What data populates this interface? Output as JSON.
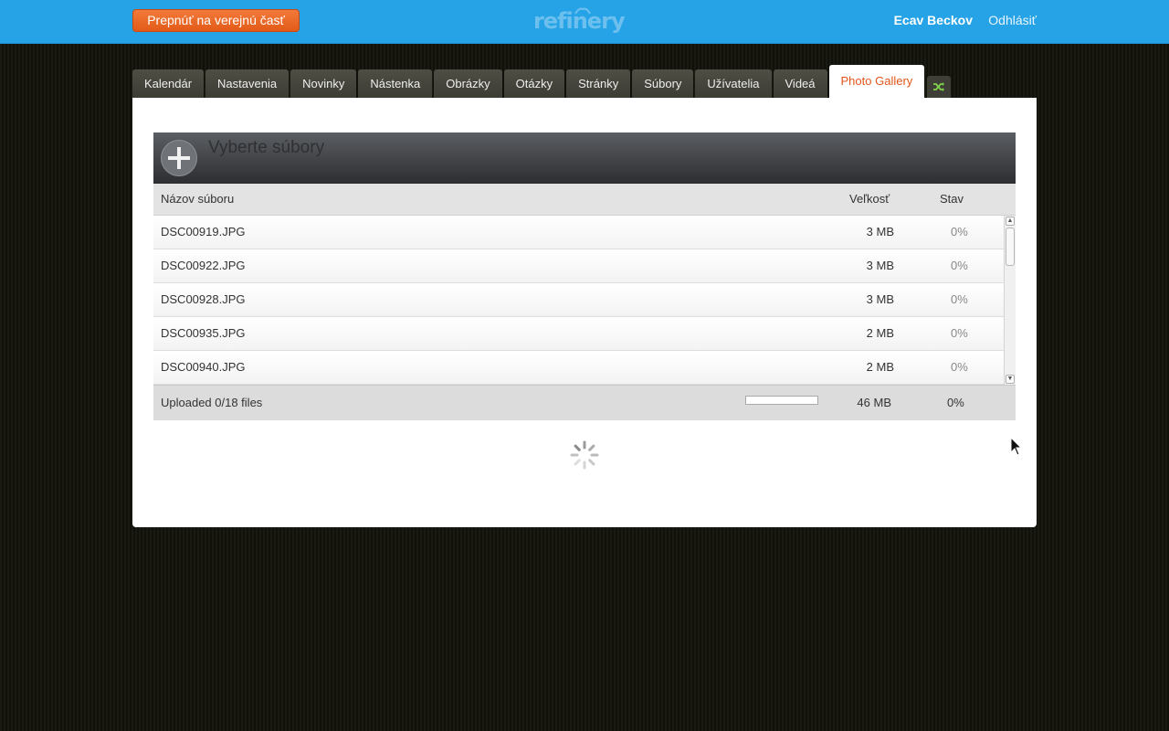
{
  "topbar": {
    "switch_label": "Prepnúť na verejnú časť",
    "logo": "refinery",
    "user_name": "Ecav Beckov",
    "logout_label": "Odhlásiť"
  },
  "tabs": [
    {
      "label": "Kalendár"
    },
    {
      "label": "Nastavenia"
    },
    {
      "label": "Novinky"
    },
    {
      "label": "Nástenka"
    },
    {
      "label": "Obrázky"
    },
    {
      "label": "Otázky"
    },
    {
      "label": "Stránky"
    },
    {
      "label": "Súbory"
    },
    {
      "label": "Užívatelia"
    },
    {
      "label": "Videá"
    },
    {
      "label": "Photo Gallery",
      "active": true
    }
  ],
  "uploader": {
    "title": "Vyberte súbory",
    "subtitle": "",
    "columns": {
      "name": "Názov súboru",
      "size": "Veľkosť",
      "status": "Stav"
    },
    "files": [
      {
        "name": "DSC00919.JPG",
        "size": "3 MB",
        "status": "0%"
      },
      {
        "name": "DSC00922.JPG",
        "size": "3 MB",
        "status": "0%"
      },
      {
        "name": "DSC00928.JPG",
        "size": "3 MB",
        "status": "0%"
      },
      {
        "name": "DSC00935.JPG",
        "size": "2 MB",
        "status": "0%"
      },
      {
        "name": "DSC00940.JPG",
        "size": "2 MB",
        "status": "0%"
      }
    ],
    "footer": {
      "status_text": "Uploaded 0/18 files",
      "progress": 0,
      "total_size": "46 MB",
      "total_percent": "0%"
    }
  },
  "colors": {
    "topbar": "#26a3e6",
    "accent": "#e2551b",
    "tab_bg": "#45453d"
  }
}
